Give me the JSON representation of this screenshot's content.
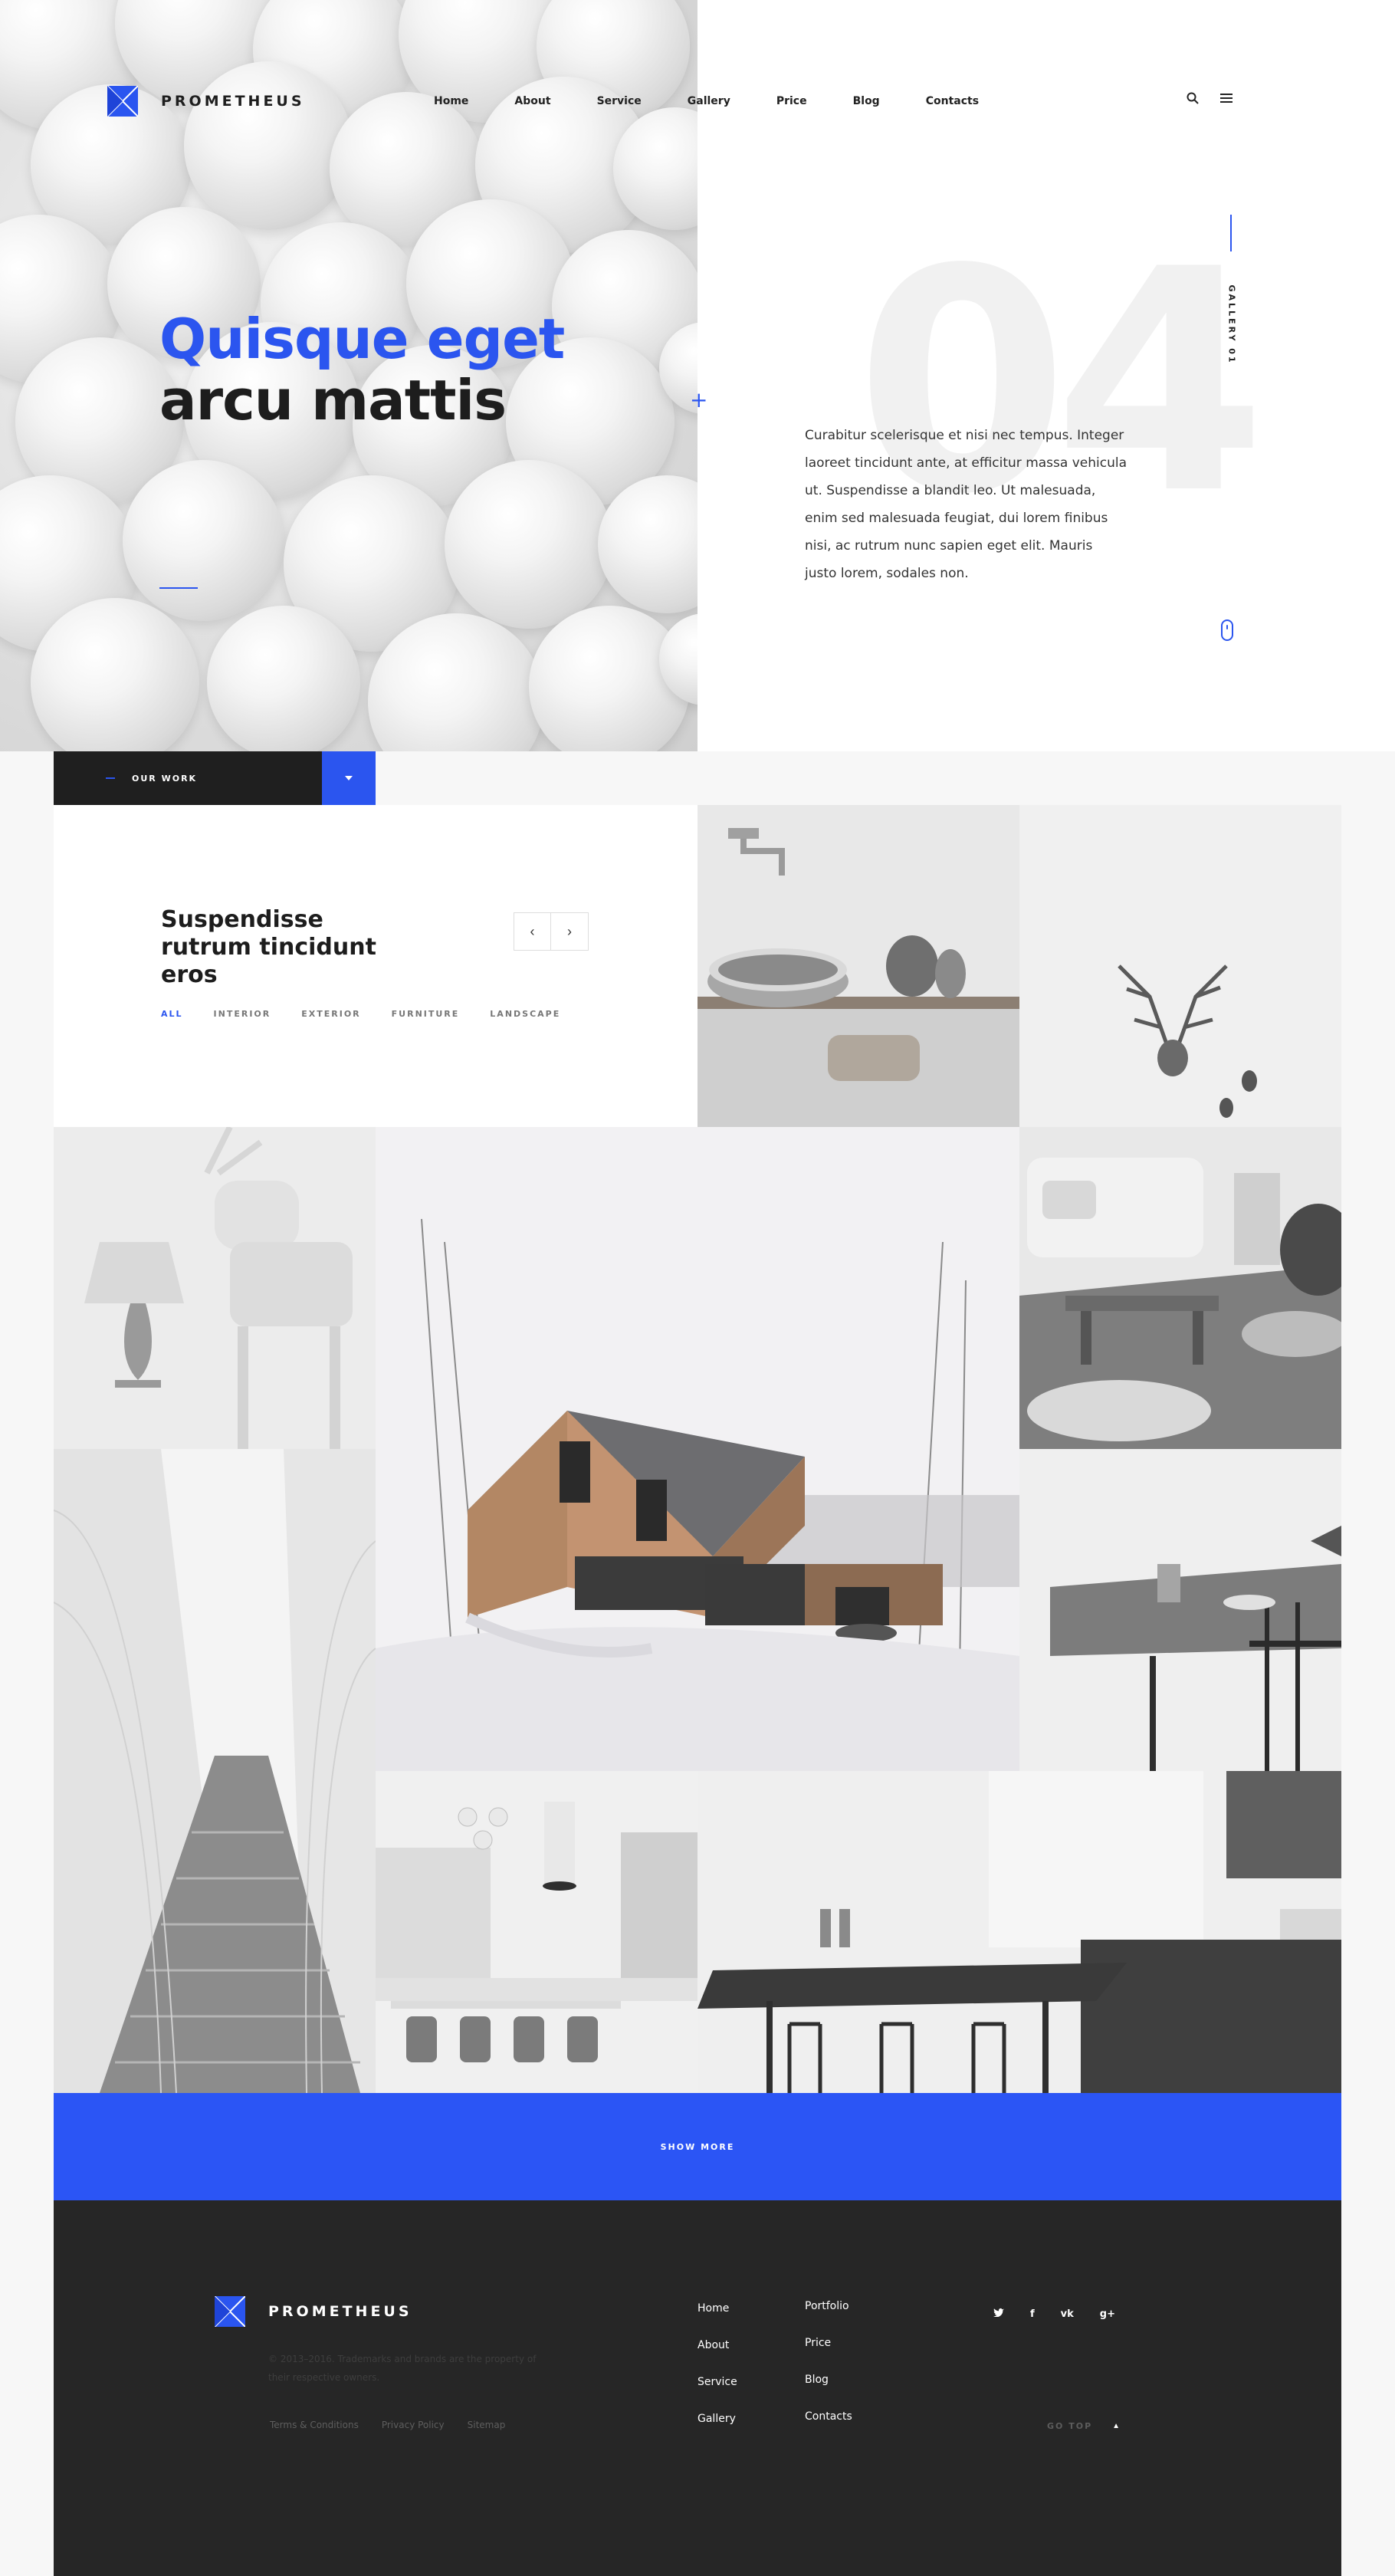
{
  "brand": {
    "name": "PROMETHEUS",
    "accent": "#2b55ef"
  },
  "nav": {
    "items": [
      "Home",
      "About",
      "Service",
      "Gallery",
      "Price",
      "Blog",
      "Contacts"
    ],
    "icons": [
      "search-icon",
      "menu-icon"
    ]
  },
  "hero": {
    "title_line1": "Quisque eget",
    "title_line2": "arcu mattis",
    "number": "04",
    "text": "Curabitur scelerisque et nisi nec tempus. Integer laoreet tincidunt ante, at efficitur massa vehicula ut. Suspendisse a blandit leo. Ut malesuada, enim sed malesuada feugiat, dui lorem finibus nisi, ac rutrum nunc sapien eget elit. Mauris justo lorem, sodales non.",
    "gallery_label": "GALLERY 01"
  },
  "work": {
    "bar_label": "OUR WORK",
    "title": "Suspendisse rutrum tincidunt eros",
    "filters": [
      "ALL",
      "INTERIOR",
      "EXTERIOR",
      "FURNITURE",
      "LANDSCAPE"
    ],
    "active_filter": "ALL",
    "show_more": "SHOW MORE"
  },
  "footer": {
    "brand": "PROMETHEUS",
    "copyright": "© 2013–2016. Trademarks and brands are the property of their respective owners.",
    "legal": [
      "Terms & Conditions",
      "Privacy Policy",
      "Sitemap"
    ],
    "col1": [
      "Home",
      "About",
      "Service",
      "Gallery"
    ],
    "col2": [
      "Portfolio",
      "Price",
      "Blog",
      "Contacts"
    ],
    "social": [
      "twitter-icon",
      "facebook-icon",
      "vk-icon",
      "google-plus-icon"
    ],
    "go_top": "GO TOP"
  }
}
